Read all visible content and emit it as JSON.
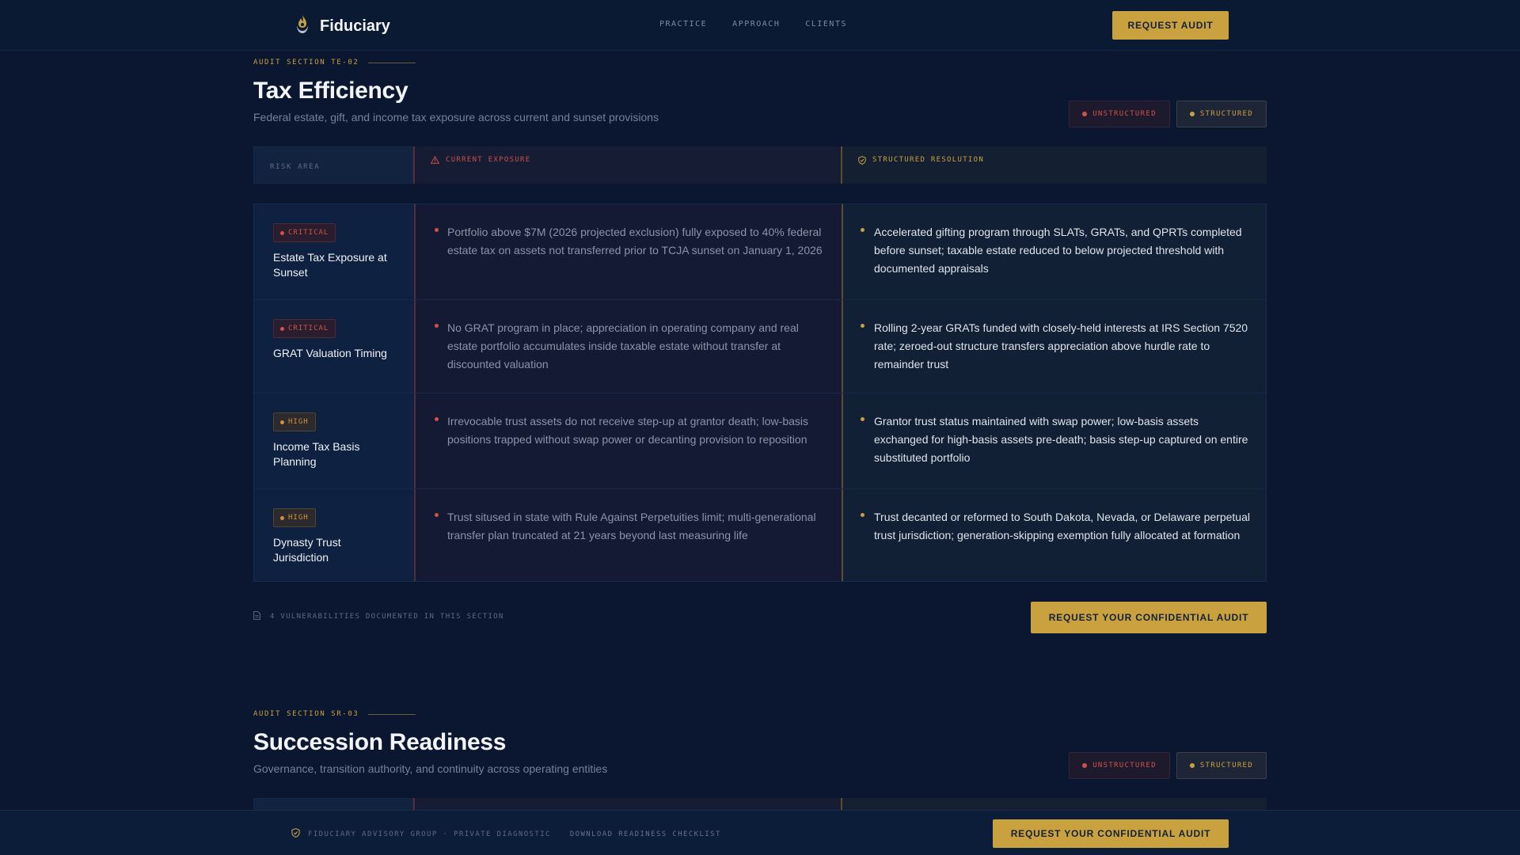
{
  "header": {
    "brand": "Fiduciary",
    "nav": [
      "PRACTICE",
      "APPROACH",
      "CLIENTS"
    ],
    "cta": "REQUEST AUDIT"
  },
  "colors": {
    "accent": "#c9a13e",
    "danger": "#d0524a",
    "high": "#d48f3c",
    "background": "#0b1730"
  },
  "legend": {
    "unstructured": "UNSTRUCTURED",
    "structured": "STRUCTURED"
  },
  "table_headers": {
    "risk_area": "RISK AREA",
    "current_exposure": "CURRENT EXPOSURE",
    "structured_resolution": "STRUCTURED RESOLUTION"
  },
  "section1": {
    "eyebrow": "AUDIT SECTION TE-02",
    "title": "Tax Efficiency",
    "subtitle": "Federal estate, gift, and income tax exposure across current and sunset provisions",
    "rows": [
      {
        "severity": "CRITICAL",
        "area": "Estate Tax Exposure at Sunset",
        "exposure": "Portfolio above $7M (2026 projected exclusion) fully exposed to 40% federal estate tax on assets not transferred prior to TCJA sunset on January 1, 2026",
        "resolution": "Accelerated gifting program through SLATs, GRATs, and QPRTs completed before sunset; taxable estate reduced to below projected threshold with documented appraisals"
      },
      {
        "severity": "CRITICAL",
        "area": "GRAT Valuation Timing",
        "exposure": "No GRAT program in place; appreciation in operating company and real estate portfolio accumulates inside taxable estate without transfer at discounted valuation",
        "resolution": "Rolling 2-year GRATs funded with closely-held interests at IRS Section 7520 rate; zeroed-out structure transfers appreciation above hurdle rate to remainder trust"
      },
      {
        "severity": "HIGH",
        "area": "Income Tax Basis Planning",
        "exposure": "Irrevocable trust assets do not receive step-up at grantor death; low-basis positions trapped without swap power or decanting provision to reposition",
        "resolution": "Grantor trust status maintained with swap power; low-basis assets exchanged for high-basis assets pre-death; basis step-up captured on entire substituted portfolio"
      },
      {
        "severity": "HIGH",
        "area": "Dynasty Trust Jurisdiction",
        "exposure": "Trust sitused in state with Rule Against Perpetuities limit; multi-generational transfer plan truncated at 21 years beyond last measuring life",
        "resolution": "Trust decanted or reformed to South Dakota, Nevada, or Delaware perpetual trust jurisdiction; generation-skipping exemption fully allocated at formation"
      }
    ],
    "footnote": "4 VULNERABILITIES DOCUMENTED IN THIS SECTION",
    "cta": "REQUEST YOUR CONFIDENTIAL AUDIT"
  },
  "section2": {
    "eyebrow": "AUDIT SECTION SR-03",
    "title": "Succession Readiness",
    "subtitle": "Governance, transition authority, and continuity across operating entities"
  },
  "bottombar": {
    "org": "FIDUCIARY ADVISORY GROUP · PRIVATE DIAGNOSTIC",
    "link": "DOWNLOAD READINESS CHECKLIST",
    "cta": "REQUEST YOUR CONFIDENTIAL AUDIT"
  }
}
